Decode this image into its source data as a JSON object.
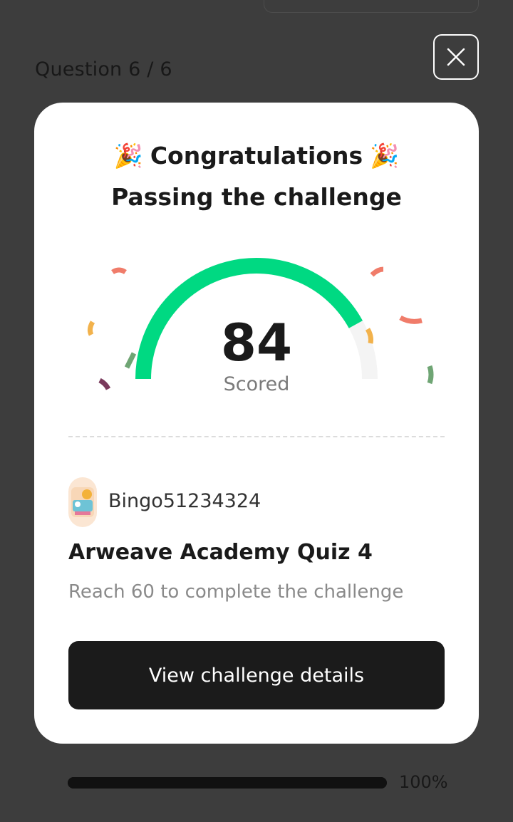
{
  "header": {
    "question_counter": "Question 6 / 6"
  },
  "modal": {
    "emoji": "🎉",
    "title": "Congratulations",
    "subtitle": "Passing the challenge",
    "score": {
      "value": "84",
      "label": "Scored",
      "fraction": 0.84
    },
    "user": {
      "name": "Bingo51234324"
    },
    "quiz": {
      "title": "Arweave Academy Quiz 4",
      "description": "Reach 60 to complete the challenge"
    },
    "cta_label": "View challenge details"
  },
  "progress": {
    "percent_text": "100%",
    "fraction": 1.0
  },
  "colors": {
    "gauge_fill": "#00d982",
    "gauge_track": "#f4f4f4",
    "button_bg": "#1b1b1b",
    "overlay": "#3d3d3d"
  }
}
